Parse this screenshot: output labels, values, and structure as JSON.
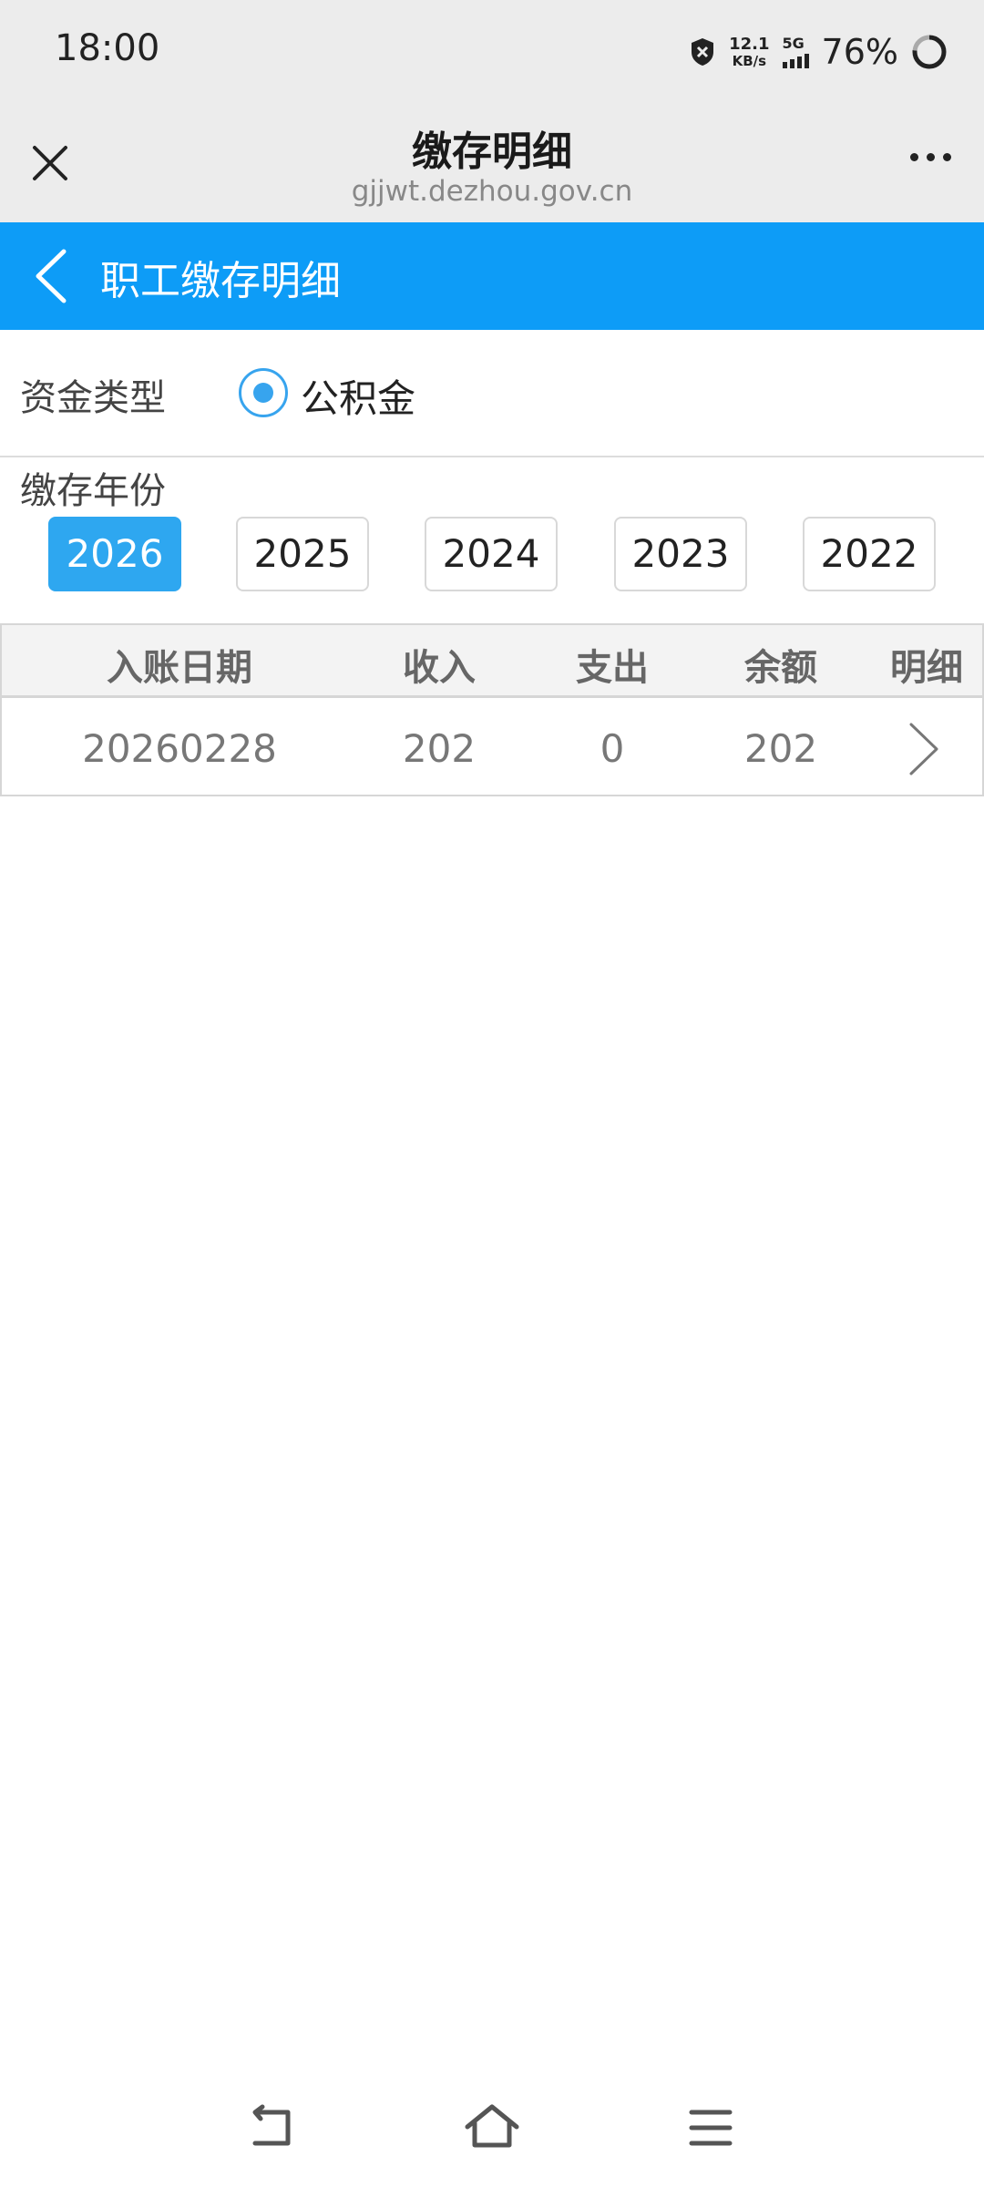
{
  "status_bar": {
    "time": "18:00",
    "net_speed": "12.1",
    "net_unit": "KB/s",
    "network": "5G",
    "battery": "76%"
  },
  "browser": {
    "title": "缴存明细",
    "url": "gjjwt.dezhou.gov.cn"
  },
  "header": {
    "title": "职工缴存明细"
  },
  "fund": {
    "label": "资金类型",
    "option": "公积金"
  },
  "years": {
    "label": "缴存年份",
    "items": [
      "2026",
      "2025",
      "2024",
      "2023",
      "2022"
    ],
    "selected": "2026"
  },
  "table": {
    "columns": [
      "入账日期",
      "收入",
      "支出",
      "余额",
      "明细"
    ],
    "rows": [
      [
        "20260228",
        "202",
        "0",
        "202"
      ]
    ]
  },
  "colors": {
    "accent": "#0d9cf7",
    "selected_year": "#2ea7f0"
  }
}
